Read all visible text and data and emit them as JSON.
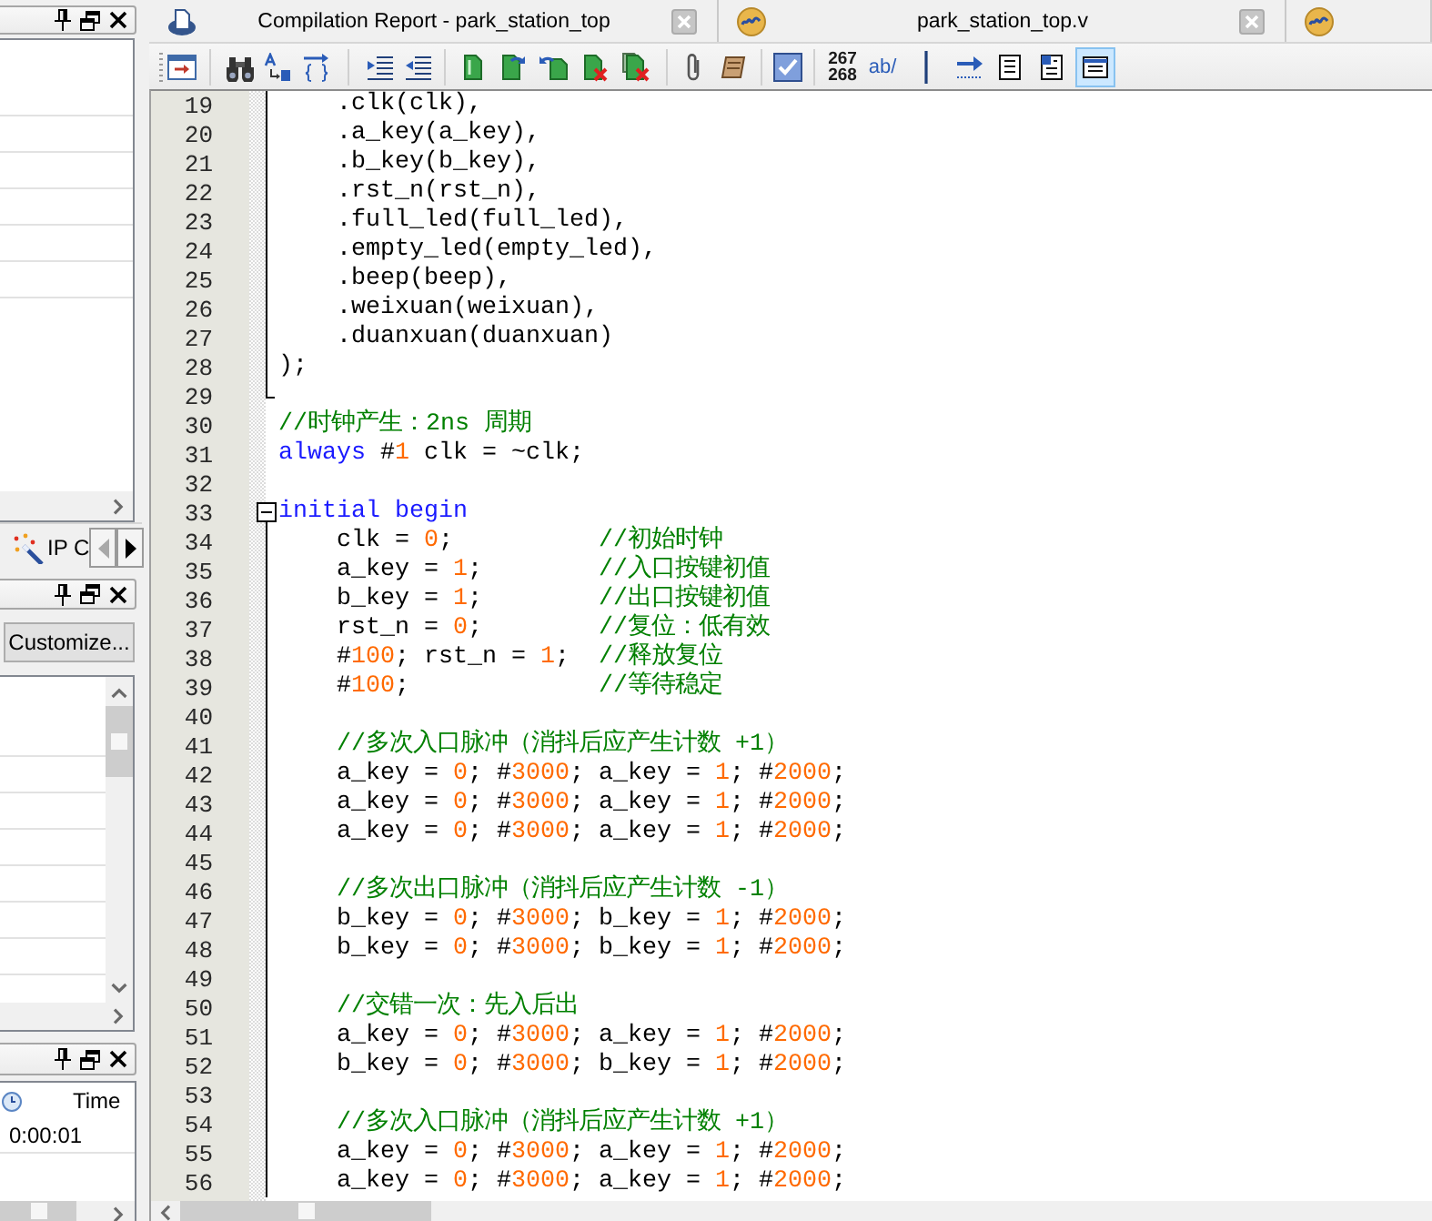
{
  "side_panels": {
    "tab": {
      "label": "IP C"
    },
    "tab_scroll_buttons": [
      {
        "disabled": true
      },
      {
        "disabled": false
      }
    ],
    "customize_button": "Customize...",
    "time_table": {
      "column": "Time",
      "rows": [
        "0:00:01"
      ]
    }
  },
  "editor": {
    "tabs": [
      {
        "kind": "report",
        "label": "Compilation Report - park_station_top",
        "closable": true
      },
      {
        "kind": "source",
        "label": "park_station_top.v",
        "closable": true
      },
      {
        "kind": "source",
        "closable": false
      }
    ],
    "toolbar": {
      "line_numbers_label": [
        "267",
        "268"
      ],
      "abbrev_label": "ab/",
      "view_toggles": [
        {
          "on": false
        },
        {
          "on": false
        },
        {
          "on": false
        },
        {
          "on": true
        }
      ]
    },
    "lines": [
      {
        "number": "19",
        "kind": "inside",
        "tokens": [
          {
            "kind": "plain",
            "text": "    .clk(clk),"
          }
        ]
      },
      {
        "number": "20",
        "kind": "inside",
        "tokens": [
          {
            "kind": "plain",
            "text": "    .a_key(a_key),"
          }
        ]
      },
      {
        "number": "21",
        "kind": "inside",
        "tokens": [
          {
            "kind": "plain",
            "text": "    .b_key(b_key),"
          }
        ]
      },
      {
        "number": "22",
        "kind": "inside",
        "tokens": [
          {
            "kind": "plain",
            "text": "    .rst_n(rst_n),"
          }
        ]
      },
      {
        "number": "23",
        "kind": "inside",
        "tokens": [
          {
            "kind": "plain",
            "text": "    .full_led(full_led),"
          }
        ]
      },
      {
        "number": "24",
        "kind": "inside",
        "tokens": [
          {
            "kind": "plain",
            "text": "    .empty_led(empty_led),"
          }
        ]
      },
      {
        "number": "25",
        "kind": "inside",
        "tokens": [
          {
            "kind": "plain",
            "text": "    .beep(beep),"
          }
        ]
      },
      {
        "number": "26",
        "kind": "inside",
        "tokens": [
          {
            "kind": "plain",
            "text": "    .weixuan(weixuan),"
          }
        ]
      },
      {
        "number": "27",
        "kind": "inside",
        "tokens": [
          {
            "kind": "plain",
            "text": "    .duanxuan(duanxuan)"
          }
        ]
      },
      {
        "number": "28",
        "kind": "inside",
        "tokens": [
          {
            "kind": "plain",
            "text": ");"
          }
        ]
      },
      {
        "number": "29",
        "kind": "end"
      },
      {
        "number": "30",
        "kind": "outside",
        "tokens": [
          {
            "kind": "comment",
            "text": "//时钟产生：2ns 周期"
          }
        ]
      },
      {
        "number": "31",
        "kind": "outside",
        "tokens": [
          {
            "kind": "keyword",
            "text": "always"
          },
          {
            "kind": "plain",
            "text": " #"
          },
          {
            "kind": "number",
            "text": "1"
          },
          {
            "kind": "plain",
            "text": " clk = ~clk;"
          }
        ]
      },
      {
        "number": "32",
        "kind": "outside"
      },
      {
        "number": "33",
        "kind": "start",
        "expanded": true,
        "tokens": [
          {
            "kind": "keyword",
            "text": "initial begin"
          }
        ]
      },
      {
        "number": "34",
        "kind": "inside",
        "tokens": [
          {
            "kind": "plain",
            "text": "    clk = "
          },
          {
            "kind": "number",
            "text": "0"
          },
          {
            "kind": "plain",
            "text": ";          "
          },
          {
            "kind": "comment",
            "text": "//初始时钟"
          }
        ]
      },
      {
        "number": "35",
        "kind": "inside",
        "tokens": [
          {
            "kind": "plain",
            "text": "    a_key = "
          },
          {
            "kind": "number",
            "text": "1"
          },
          {
            "kind": "plain",
            "text": ";        "
          },
          {
            "kind": "comment",
            "text": "//入口按键初值"
          }
        ]
      },
      {
        "number": "36",
        "kind": "inside",
        "tokens": [
          {
            "kind": "plain",
            "text": "    b_key = "
          },
          {
            "kind": "number",
            "text": "1"
          },
          {
            "kind": "plain",
            "text": ";        "
          },
          {
            "kind": "comment",
            "text": "//出口按键初值"
          }
        ]
      },
      {
        "number": "37",
        "kind": "inside",
        "tokens": [
          {
            "kind": "plain",
            "text": "    rst_n = "
          },
          {
            "kind": "number",
            "text": "0"
          },
          {
            "kind": "plain",
            "text": ";        "
          },
          {
            "kind": "comment",
            "text": "//复位：低有效"
          }
        ]
      },
      {
        "number": "38",
        "kind": "inside",
        "tokens": [
          {
            "kind": "plain",
            "text": "    #"
          },
          {
            "kind": "number",
            "text": "100"
          },
          {
            "kind": "plain",
            "text": "; rst_n = "
          },
          {
            "kind": "number",
            "text": "1"
          },
          {
            "kind": "plain",
            "text": ";  "
          },
          {
            "kind": "comment",
            "text": "//释放复位"
          }
        ]
      },
      {
        "number": "39",
        "kind": "inside",
        "tokens": [
          {
            "kind": "plain",
            "text": "    #"
          },
          {
            "kind": "number",
            "text": "100"
          },
          {
            "kind": "plain",
            "text": ";             "
          },
          {
            "kind": "comment",
            "text": "//等待稳定"
          }
        ]
      },
      {
        "number": "40",
        "kind": "inside"
      },
      {
        "number": "41",
        "kind": "inside",
        "tokens": [
          {
            "kind": "comment",
            "text": "    //多次入口脉冲（消抖后应产生计数 +1）"
          }
        ]
      },
      {
        "number": "42",
        "kind": "inside",
        "tokens": [
          {
            "kind": "plain",
            "text": "    a_key = "
          },
          {
            "kind": "number",
            "text": "0"
          },
          {
            "kind": "plain",
            "text": "; #"
          },
          {
            "kind": "number",
            "text": "3000"
          },
          {
            "kind": "plain",
            "text": "; a_key = "
          },
          {
            "kind": "number",
            "text": "1"
          },
          {
            "kind": "plain",
            "text": "; #"
          },
          {
            "kind": "number",
            "text": "2000"
          },
          {
            "kind": "plain",
            "text": ";"
          }
        ]
      },
      {
        "number": "43",
        "kind": "inside",
        "tokens": [
          {
            "kind": "plain",
            "text": "    a_key = "
          },
          {
            "kind": "number",
            "text": "0"
          },
          {
            "kind": "plain",
            "text": "; #"
          },
          {
            "kind": "number",
            "text": "3000"
          },
          {
            "kind": "plain",
            "text": "; a_key = "
          },
          {
            "kind": "number",
            "text": "1"
          },
          {
            "kind": "plain",
            "text": "; #"
          },
          {
            "kind": "number",
            "text": "2000"
          },
          {
            "kind": "plain",
            "text": ";"
          }
        ]
      },
      {
        "number": "44",
        "kind": "inside",
        "tokens": [
          {
            "kind": "plain",
            "text": "    a_key = "
          },
          {
            "kind": "number",
            "text": "0"
          },
          {
            "kind": "plain",
            "text": "; #"
          },
          {
            "kind": "number",
            "text": "3000"
          },
          {
            "kind": "plain",
            "text": "; a_key = "
          },
          {
            "kind": "number",
            "text": "1"
          },
          {
            "kind": "plain",
            "text": "; #"
          },
          {
            "kind": "number",
            "text": "2000"
          },
          {
            "kind": "plain",
            "text": ";"
          }
        ]
      },
      {
        "number": "45",
        "kind": "inside"
      },
      {
        "number": "46",
        "kind": "inside",
        "tokens": [
          {
            "kind": "comment",
            "text": "    //多次出口脉冲（消抖后应产生计数 -1）"
          }
        ]
      },
      {
        "number": "47",
        "kind": "inside",
        "tokens": [
          {
            "kind": "plain",
            "text": "    b_key = "
          },
          {
            "kind": "number",
            "text": "0"
          },
          {
            "kind": "plain",
            "text": "; #"
          },
          {
            "kind": "number",
            "text": "3000"
          },
          {
            "kind": "plain",
            "text": "; b_key = "
          },
          {
            "kind": "number",
            "text": "1"
          },
          {
            "kind": "plain",
            "text": "; #"
          },
          {
            "kind": "number",
            "text": "2000"
          },
          {
            "kind": "plain",
            "text": ";"
          }
        ]
      },
      {
        "number": "48",
        "kind": "inside",
        "tokens": [
          {
            "kind": "plain",
            "text": "    b_key = "
          },
          {
            "kind": "number",
            "text": "0"
          },
          {
            "kind": "plain",
            "text": "; #"
          },
          {
            "kind": "number",
            "text": "3000"
          },
          {
            "kind": "plain",
            "text": "; b_key = "
          },
          {
            "kind": "number",
            "text": "1"
          },
          {
            "kind": "plain",
            "text": "; #"
          },
          {
            "kind": "number",
            "text": "2000"
          },
          {
            "kind": "plain",
            "text": ";"
          }
        ]
      },
      {
        "number": "49",
        "kind": "inside"
      },
      {
        "number": "50",
        "kind": "inside",
        "tokens": [
          {
            "kind": "comment",
            "text": "    //交错一次：先入后出"
          }
        ]
      },
      {
        "number": "51",
        "kind": "inside",
        "tokens": [
          {
            "kind": "plain",
            "text": "    a_key = "
          },
          {
            "kind": "number",
            "text": "0"
          },
          {
            "kind": "plain",
            "text": "; #"
          },
          {
            "kind": "number",
            "text": "3000"
          },
          {
            "kind": "plain",
            "text": "; a_key = "
          },
          {
            "kind": "number",
            "text": "1"
          },
          {
            "kind": "plain",
            "text": "; #"
          },
          {
            "kind": "number",
            "text": "2000"
          },
          {
            "kind": "plain",
            "text": ";"
          }
        ]
      },
      {
        "number": "52",
        "kind": "inside",
        "tokens": [
          {
            "kind": "plain",
            "text": "    b_key = "
          },
          {
            "kind": "number",
            "text": "0"
          },
          {
            "kind": "plain",
            "text": "; #"
          },
          {
            "kind": "number",
            "text": "3000"
          },
          {
            "kind": "plain",
            "text": "; b_key = "
          },
          {
            "kind": "number",
            "text": "1"
          },
          {
            "kind": "plain",
            "text": "; #"
          },
          {
            "kind": "number",
            "text": "2000"
          },
          {
            "kind": "plain",
            "text": ";"
          }
        ]
      },
      {
        "number": "53",
        "kind": "inside"
      },
      {
        "number": "54",
        "kind": "inside",
        "tokens": [
          {
            "kind": "comment",
            "text": "    //多次入口脉冲（消抖后应产生计数 +1）"
          }
        ]
      },
      {
        "number": "55",
        "kind": "inside",
        "tokens": [
          {
            "kind": "plain",
            "text": "    a_key = "
          },
          {
            "kind": "number",
            "text": "0"
          },
          {
            "kind": "plain",
            "text": "; #"
          },
          {
            "kind": "number",
            "text": "3000"
          },
          {
            "kind": "plain",
            "text": "; a_key = "
          },
          {
            "kind": "number",
            "text": "1"
          },
          {
            "kind": "plain",
            "text": "; #"
          },
          {
            "kind": "number",
            "text": "2000"
          },
          {
            "kind": "plain",
            "text": ";"
          }
        ]
      },
      {
        "number": "56",
        "kind": "inside",
        "tokens": [
          {
            "kind": "plain",
            "text": "    a_key = "
          },
          {
            "kind": "number",
            "text": "0"
          },
          {
            "kind": "plain",
            "text": "; #"
          },
          {
            "kind": "number",
            "text": "3000"
          },
          {
            "kind": "plain",
            "text": "; a_key = "
          },
          {
            "kind": "number",
            "text": "1"
          },
          {
            "kind": "plain",
            "text": "; #"
          },
          {
            "kind": "number",
            "text": "2000"
          },
          {
            "kind": "plain",
            "text": ";"
          }
        ]
      }
    ]
  }
}
